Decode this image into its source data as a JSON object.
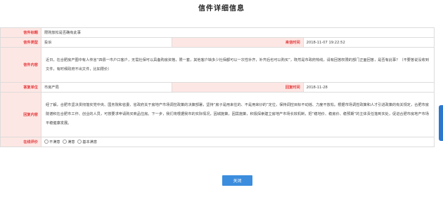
{
  "page": {
    "title": "信件详细信息"
  },
  "detail": {
    "subject": {
      "label": "信件标题",
      "value": "限购放松是否确有此事"
    },
    "type": {
      "label": "信件类型",
      "value": "投诉"
    },
    "send_time": {
      "label": "来信时间",
      "value": "2018-11-07 19:22:52"
    },
    "content": {
      "label": "信件内容",
      "value": "近日，在合肥房产圈中有人传言“四县一市户口客户，无需社保可以具备购房资格，限一套，其他客户缺多少社保都可以一次性补齐，补齐后也可以购买”，既然是市政府热线，请有回答权限的部门正面回答，是否有此事？（不要答说没收到文件，有时候政府不出文件，比如限价）"
    },
    "reply_unit": {
      "label": "答复单位",
      "value": "市房产局"
    },
    "reply_time": {
      "label": "回复时间",
      "value": "2018-11-28"
    },
    "reply_content": {
      "label": "回复内容",
      "value": "经了解，合肥市坚决贯彻落实党中央、国务院和省委、省政府关于房地产市场调控政策的决策部署，坚持“房子是用来住的、不是用来炒的”定位，保持调控目标不动摇、力度不放松。根据市场调控政策和人才引进政策的有关规定，合肥市房院谱积在合肥市工作、创业的人员，可按要求申请购买商品住房。下一步，我们将根据我市的实际情况，因城施策，因需施策，积极探索建立房地产市场长效机制，把“稳地价、稳房价、稳预期”的主体责任落到实处，促进合肥市房地产市场平稳健康发展。"
    },
    "rating": {
      "label": "在线评价",
      "options": [
        "不满意",
        "满意",
        "基本满意"
      ]
    }
  },
  "actions": {
    "close_label": "关闭"
  },
  "colors": {
    "label_bg": "#fde7e4",
    "label_text": "#e4393c",
    "button": "#3c8dde",
    "side_tab": "#2b77d0"
  }
}
